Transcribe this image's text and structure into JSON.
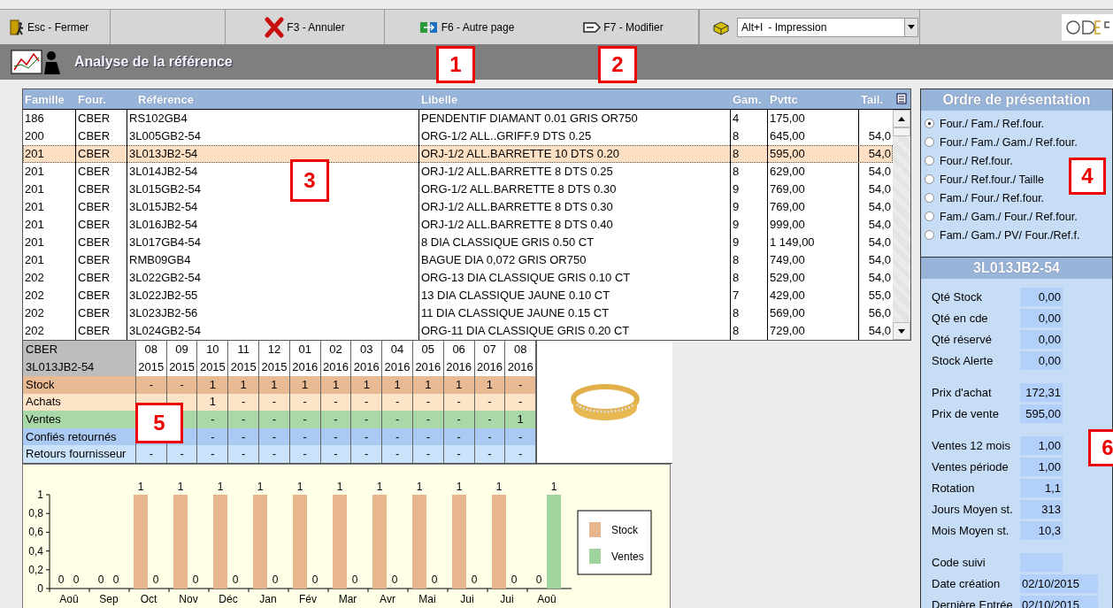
{
  "toolbar": {
    "buttons": [
      {
        "kind": "button",
        "label": "Esc - Fermer"
      },
      {
        "kind": "blank"
      },
      {
        "kind": "button",
        "label": "F3 - Annuler"
      },
      {
        "kind": "button",
        "label": "F6 - Autre page"
      },
      {
        "kind": "button",
        "label": "F7 - Modifier"
      }
    ],
    "print_select": {
      "shortcut": "Alt+I",
      "value": "- Impression"
    }
  },
  "page_title": "Analyse de la référence",
  "table": {
    "columns": [
      "Famille",
      "Four.",
      "Référence",
      "Libelle",
      "Gam.",
      "Pvttc",
      "Tail."
    ],
    "rows": [
      {
        "cells": [
          "186",
          "CBER",
          "RS102GB4",
          "PENDENTIF DIAMANT 0.01 GRIS OR750",
          "4",
          "175,00",
          ""
        ],
        "selected": false
      },
      {
        "cells": [
          "200",
          "CBER",
          "3L005GB2-54",
          "ORG-1/2 ALL..GRIFF.9 DTS 0.25",
          "8",
          "645,00",
          "54,0"
        ],
        "selected": false
      },
      {
        "cells": [
          "201",
          "CBER",
          "3L013JB2-54",
          "ORJ-1/2 ALL.BARRETTE 10 DTS 0.20",
          "8",
          "595,00",
          "54,0"
        ],
        "selected": true
      },
      {
        "cells": [
          "201",
          "CBER",
          "3L014JB2-54",
          "ORJ-1/2 ALL.BARRETTE 8 DTS 0.25",
          "8",
          "629,00",
          "54,0"
        ],
        "selected": false
      },
      {
        "cells": [
          "201",
          "CBER",
          "3L015GB2-54",
          "ORG-1/2 ALL.BARRETTE 8 DTS 0.30",
          "9",
          "769,00",
          "54,0"
        ],
        "selected": false
      },
      {
        "cells": [
          "201",
          "CBER",
          "3L015JB2-54",
          "ORJ-1/2 ALL.BARRETTE 8 DTS 0.30",
          "9",
          "769,00",
          "54,0"
        ],
        "selected": false
      },
      {
        "cells": [
          "201",
          "CBER",
          "3L016JB2-54",
          "ORJ-1/2 ALL.BARRETTE 8 DTS 0.40",
          "9",
          "999,00",
          "54,0"
        ],
        "selected": false
      },
      {
        "cells": [
          "201",
          "CBER",
          "3L017GB4-54",
          "8 DIA CLASSIQUE GRIS 0.50 CT",
          "9",
          "1 149,00",
          "54,0"
        ],
        "selected": false
      },
      {
        "cells": [
          "201",
          "CBER",
          "RMB09GB4",
          "BAGUE DIA 0,072 GRIS OR750",
          "8",
          "749,00",
          "54,0"
        ],
        "selected": false
      },
      {
        "cells": [
          "202",
          "CBER",
          "3L022GB2-54",
          "ORG-13 DIA CLASSIQUE GRIS 0.10 CT",
          "8",
          "529,00",
          "54,0"
        ],
        "selected": false
      },
      {
        "cells": [
          "202",
          "CBER",
          "3L022JB2-55",
          "13 DIA CLASSIQUE JAUNE 0.10 CT",
          "7",
          "429,00",
          "55,0"
        ],
        "selected": false
      },
      {
        "cells": [
          "202",
          "CBER",
          "3L023JB2-56",
          "11 DIA CLASSIQUE JAUNE 0.15 CT",
          "8",
          "569,00",
          "56,0"
        ],
        "selected": false
      },
      {
        "cells": [
          "202",
          "CBER",
          "3L024GB2-54",
          "ORG-11 DIA CLASSIQUE GRIS 0.20 CT",
          "8",
          "729,00",
          "54,0"
        ],
        "selected": false
      }
    ]
  },
  "history": {
    "supplier": "CBER",
    "reference": "3L013JB2-54",
    "months": [
      {
        "month": "08",
        "year": "2015"
      },
      {
        "month": "09",
        "year": "2015"
      },
      {
        "month": "10",
        "year": "2015"
      },
      {
        "month": "11",
        "year": "2015"
      },
      {
        "month": "12",
        "year": "2015"
      },
      {
        "month": "01",
        "year": "2016"
      },
      {
        "month": "02",
        "year": "2016"
      },
      {
        "month": "03",
        "year": "2016"
      },
      {
        "month": "04",
        "year": "2016"
      },
      {
        "month": "05",
        "year": "2016"
      },
      {
        "month": "06",
        "year": "2016"
      },
      {
        "month": "07",
        "year": "2016"
      },
      {
        "month": "08",
        "year": "2016"
      }
    ],
    "rows": [
      {
        "label": "Stock",
        "kind": "stock",
        "values": [
          "-",
          "-",
          "1",
          "1",
          "1",
          "1",
          "1",
          "1",
          "1",
          "1",
          "1",
          "1",
          "-"
        ]
      },
      {
        "label": "Achats",
        "kind": "purchases",
        "values": [
          "1",
          "-",
          "-",
          "-",
          "-",
          "-",
          "-",
          "-",
          "-",
          "-",
          "-"
        ]
      },
      {
        "label": "Ventes",
        "kind": "sales",
        "values": [
          "-",
          "-",
          "-",
          "-",
          "-",
          "-",
          "-",
          "-",
          "-",
          "-",
          "1"
        ]
      },
      {
        "label": "Confiés retournés",
        "kind": "consigned",
        "values": [
          "-",
          "-",
          "-",
          "-",
          "-",
          "-",
          "-",
          "-",
          "-",
          "-",
          "-"
        ]
      },
      {
        "label": "Retours fournisseur",
        "kind": "returns",
        "values": [
          "-",
          "-",
          "-",
          "-",
          "-",
          "-",
          "-",
          "-",
          "-",
          "-",
          "-",
          "-",
          "-"
        ]
      }
    ]
  },
  "chart_data": {
    "type": "bar",
    "categories": [
      "Aoû",
      "Sep",
      "Oct",
      "Nov",
      "Déc",
      "Jan",
      "Fév",
      "Mar",
      "Avr",
      "Mai",
      "Jui",
      "Jui",
      "Aoû"
    ],
    "series": [
      {
        "name": "Stock",
        "color": "#e8b68c",
        "values": [
          0,
          0,
          1,
          1,
          1,
          1,
          1,
          1,
          1,
          1,
          1,
          1,
          0
        ]
      },
      {
        "name": "Ventes",
        "color": "#9fd49f",
        "values": [
          0,
          0,
          0,
          0,
          0,
          0,
          0,
          0,
          0,
          0,
          0,
          0,
          1
        ]
      }
    ],
    "ylim": [
      0,
      1
    ],
    "yticks": [
      {
        "value": 0,
        "label": "0"
      },
      {
        "value": 0.2,
        "label": "0,2"
      },
      {
        "value": 0.4,
        "label": "0,4"
      },
      {
        "value": 0.6,
        "label": "0,6"
      },
      {
        "value": 0.8,
        "label": "0,8"
      },
      {
        "value": 1,
        "label": "1"
      }
    ],
    "data_labels": true,
    "legend": "right"
  },
  "order_panel": {
    "title": "Ordre de présentation",
    "options": [
      {
        "label": "Four./ Fam./ Ref.four.",
        "selected": true
      },
      {
        "label": "Four./ Fam./ Gam./ Ref.four.",
        "selected": false
      },
      {
        "label": "Four./ Ref.four.",
        "selected": false
      },
      {
        "label": "Four./ Ref.four./ Taille",
        "selected": false
      },
      {
        "label": "Fam./ Four./ Ref.four.",
        "selected": false
      },
      {
        "label": "Fam./ Gam./ Four./ Ref.four.",
        "selected": false
      },
      {
        "label": "Fam./ Gam./ PV/ Four./Ref.f.",
        "selected": false
      }
    ]
  },
  "detail": {
    "title": "3L013JB2-54",
    "groups": [
      [
        {
          "label": "Qté Stock",
          "value": "0,00"
        },
        {
          "label": "Qté en cde",
          "value": "0,00"
        },
        {
          "label": "Qté réservé",
          "value": "0,00"
        },
        {
          "label": "Stock Alerte",
          "value": "0,00"
        }
      ],
      [
        {
          "label": "Prix d'achat",
          "value": "172,31"
        },
        {
          "label": "Prix de vente",
          "value": "595,00"
        }
      ],
      [
        {
          "label": "Ventes 12 mois",
          "value": "1,00"
        },
        {
          "label": "Ventes période",
          "value": "1,00"
        },
        {
          "label": "Rotation",
          "value": "1,1"
        },
        {
          "label": "Jours Moyen st.",
          "value": "313"
        },
        {
          "label": "Mois Moyen st.",
          "value": "10,3"
        }
      ],
      [
        {
          "label": "Code suivi"
        },
        {
          "label": "Date création",
          "value": "02/10/2015"
        },
        {
          "label": "Dernière Entrée",
          "value": "02/10/2015"
        }
      ]
    ]
  },
  "callouts": [
    "1",
    "2",
    "3",
    "4",
    "5",
    "6"
  ]
}
